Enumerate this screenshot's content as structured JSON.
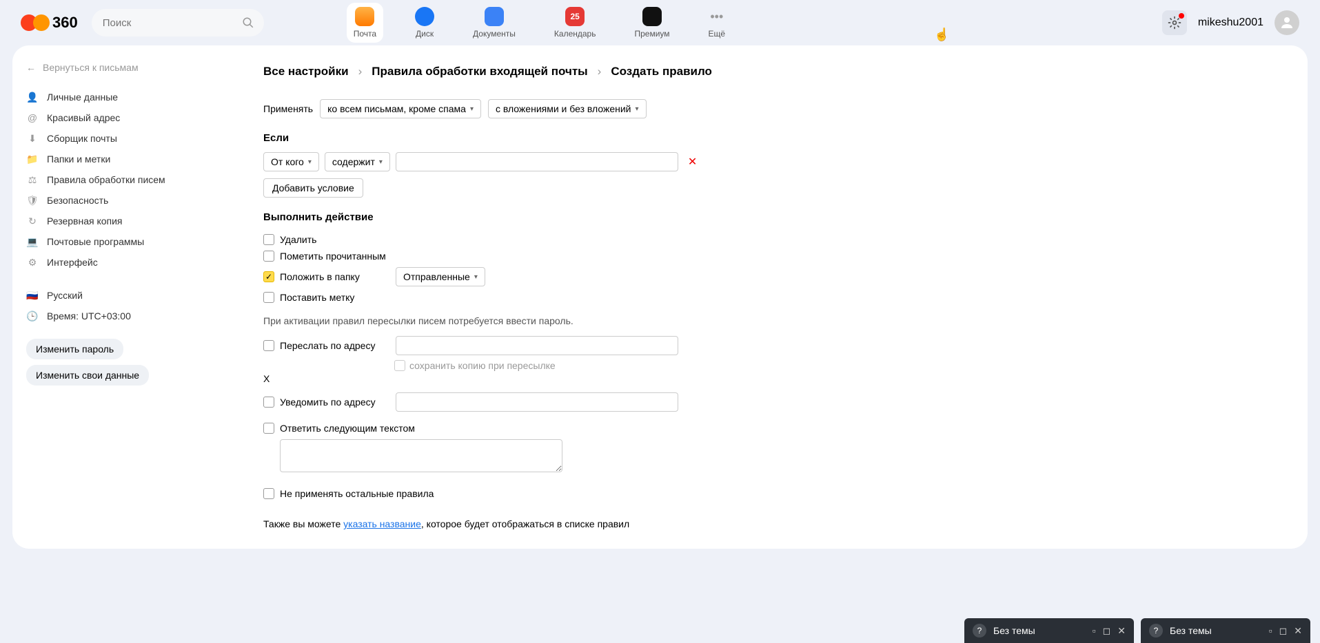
{
  "header": {
    "logo_text": "360",
    "search_placeholder": "Поиск",
    "apps": [
      {
        "label": "Почта",
        "color": "#ff9500",
        "active": true
      },
      {
        "label": "Диск",
        "color": "#1976f5",
        "active": false
      },
      {
        "label": "Документы",
        "color": "#3b82f6",
        "active": false
      },
      {
        "label": "Календарь",
        "color": "#e53935",
        "badge": "25",
        "active": false
      },
      {
        "label": "Премиум",
        "color": "#222",
        "active": false
      },
      {
        "label": "Ещё",
        "color": "#ccc",
        "dots": true,
        "active": false
      }
    ],
    "username": "mikeshu2001"
  },
  "sidebar": {
    "back": "Вернуться к письмам",
    "items": [
      {
        "icon": "user",
        "label": "Личные данные"
      },
      {
        "icon": "at",
        "label": "Красивый адрес"
      },
      {
        "icon": "inbox",
        "label": "Сборщик почты"
      },
      {
        "icon": "folder",
        "label": "Папки и метки"
      },
      {
        "icon": "rules",
        "label": "Правила обработки писем"
      },
      {
        "icon": "shield",
        "label": "Безопасность"
      },
      {
        "icon": "backup",
        "label": "Резервная копия"
      },
      {
        "icon": "device",
        "label": "Почтовые программы"
      },
      {
        "icon": "sliders",
        "label": "Интерфейс"
      }
    ],
    "lang": "Русский",
    "time": "Время: UTC+03:00",
    "change_password": "Изменить пароль",
    "change_data": "Изменить свои данные"
  },
  "breadcrumb": {
    "all": "Все настройки",
    "rules": "Правила обработки входящей почты",
    "create": "Создать правило"
  },
  "form": {
    "apply_label": "Применять",
    "apply_sel1": "ко всем письмам, кроме спама",
    "apply_sel2": "с вложениями и без вложений",
    "if_title": "Если",
    "cond_field": "От кого",
    "cond_op": "содержит",
    "add_cond": "Добавить условие",
    "action_title": "Выполнить действие",
    "act_delete": "Удалить",
    "act_read": "Пометить прочитанным",
    "act_folder": "Положить в папку",
    "folder_sel": "Отправленные",
    "act_label": "Поставить метку",
    "pwd_note": "При активации правил пересылки писем потребуется ввести пароль.",
    "act_forward": "Переслать по адресу",
    "act_keep_copy": "сохранить копию при пересылке",
    "act_notify": "Уведомить по адресу",
    "act_reply": "Ответить следующим текстом",
    "act_skip": "Не применять остальные правила",
    "name_prefix": "Также вы можете ",
    "name_link": "указать название",
    "name_suffix": ", которое будет отображаться в списке правил"
  },
  "tray": {
    "item1": "Без темы",
    "item2": "Без темы"
  }
}
